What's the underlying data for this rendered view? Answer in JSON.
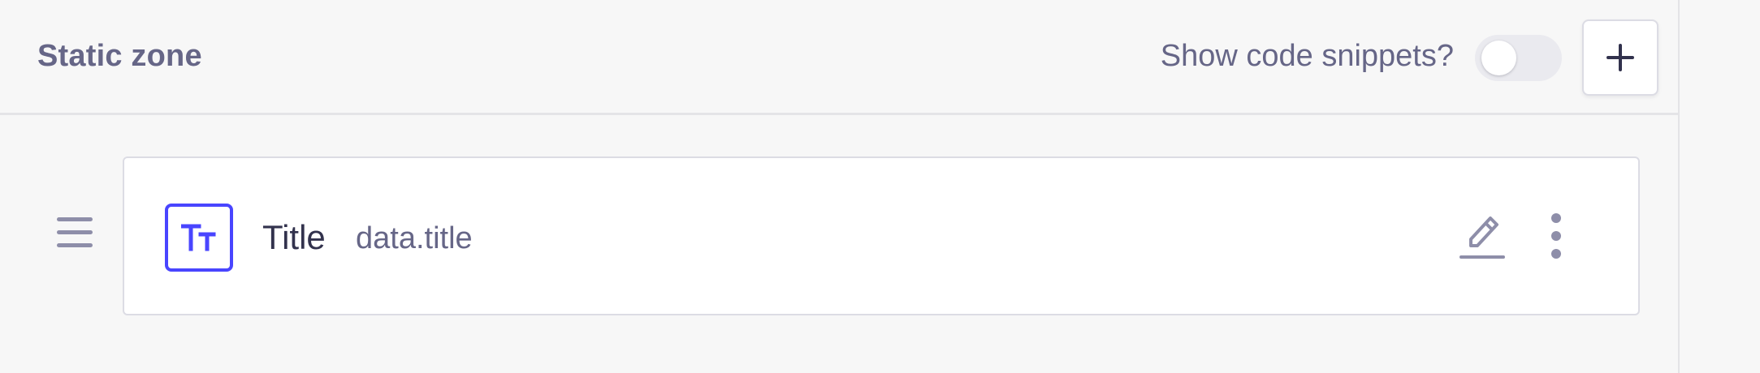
{
  "header": {
    "title": "Static zone",
    "snippets_label": "Show code snippets?",
    "snippets_enabled": false,
    "add_icon": "plus-icon"
  },
  "fields": [
    {
      "icon": "text-icon",
      "name": "Title",
      "path": "data.title"
    }
  ],
  "icons": {
    "drag": "drag-handle-icon",
    "edit": "pencil-icon",
    "more": "more-vertical-icon"
  },
  "colors": {
    "accent": "#4945ff",
    "text_primary": "#32324d",
    "text_secondary": "#666687",
    "border": "#dcdce4",
    "background": "#f7f7f7"
  }
}
